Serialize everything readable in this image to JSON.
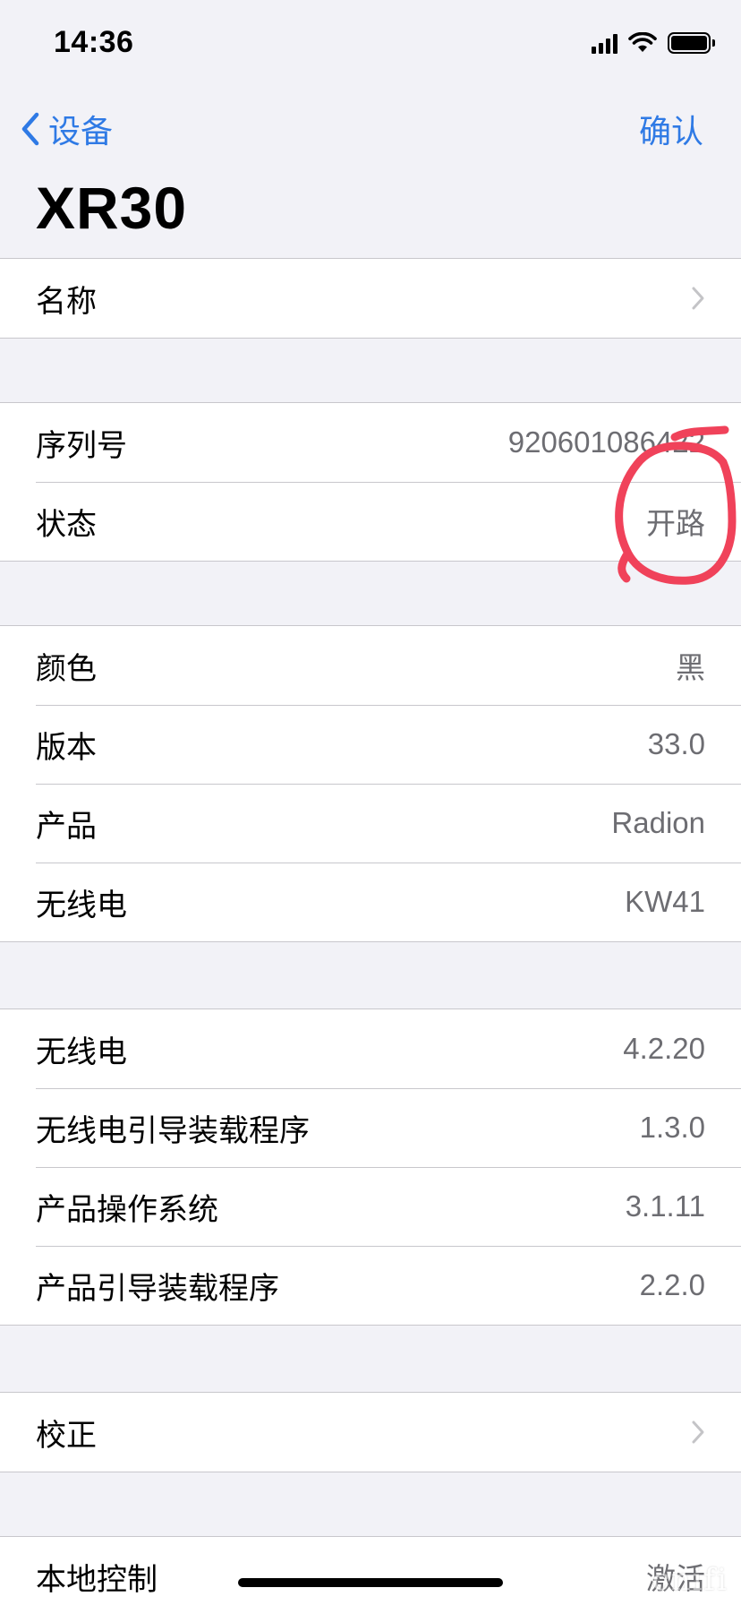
{
  "status_bar": {
    "time": "14:36",
    "icons": [
      "signal-icon",
      "wifi-icon",
      "battery-icon"
    ]
  },
  "nav": {
    "back_label": "设备",
    "confirm_label": "确认",
    "accent_color": "#2f7ae5"
  },
  "page_title": "XR30",
  "groups": [
    {
      "rows": [
        {
          "label": "名称",
          "value": "",
          "chevron": true
        }
      ]
    },
    {
      "rows": [
        {
          "label": "序列号",
          "value": "920601086422",
          "chevron": false
        },
        {
          "label": "状态",
          "value": "开路",
          "chevron": false
        }
      ]
    },
    {
      "rows": [
        {
          "label": "颜色",
          "value": "黑",
          "chevron": false
        },
        {
          "label": "版本",
          "value": "33.0",
          "chevron": false
        },
        {
          "label": "产品",
          "value": "Radion",
          "chevron": false
        },
        {
          "label": "无线电",
          "value": "KW41",
          "chevron": false
        }
      ]
    },
    {
      "rows": [
        {
          "label": "无线电",
          "value": "4.2.20",
          "chevron": false
        },
        {
          "label": "无线电引导装载程序",
          "value": "1.3.0",
          "chevron": false
        },
        {
          "label": "产品操作系统",
          "value": "3.1.11",
          "chevron": false
        },
        {
          "label": "产品引导装载程序",
          "value": "2.2.0",
          "chevron": false
        }
      ]
    },
    {
      "rows": [
        {
          "label": "校正",
          "value": "",
          "chevron": true
        }
      ]
    },
    {
      "rows": [
        {
          "label": "本地控制",
          "value": "激活",
          "chevron": false
        }
      ]
    }
  ],
  "annotation_color": "#f0425a",
  "watermark": "cnifi"
}
